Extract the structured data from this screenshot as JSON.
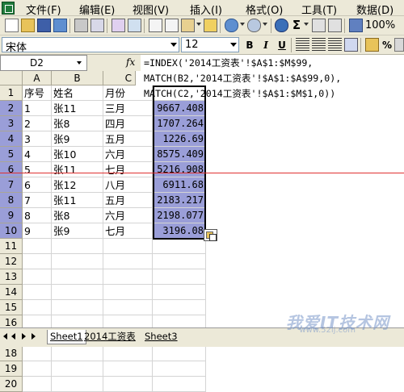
{
  "menu": [
    "文件(F)",
    "编辑(E)",
    "视图(V)",
    "插入(I)",
    "格式(O)",
    "工具(T)",
    "数据(D)"
  ],
  "toolbar": {
    "font_name": "宋体",
    "font_size": "12",
    "zoom": "100%",
    "bold": "B",
    "italic": "I",
    "underline": "U",
    "sigma": "Σ",
    "percent": "%"
  },
  "name_box": "D2",
  "fx_label": "fx",
  "formula_lines": [
    "=INDEX('2014工资表'!$A$1:$M$99,",
    "MATCH(B2,'2014工资表'!$A$1:$A$99,0),",
    "MATCH(C2,'2014工资表'!$A$1:$M$1,0))"
  ],
  "columns": [
    "A",
    "B",
    "C"
  ],
  "rows": [
    "1",
    "2",
    "3",
    "4",
    "5",
    "6",
    "7",
    "8",
    "9",
    "10",
    "11",
    "12",
    "13",
    "14",
    "15",
    "16",
    "17",
    "18",
    "19",
    "20"
  ],
  "header_row": [
    "序号",
    "姓名",
    "月份"
  ],
  "data": [
    {
      "seq": "1",
      "name": "张11",
      "month": "三月",
      "value": "9667.408"
    },
    {
      "seq": "2",
      "name": "张8",
      "month": "四月",
      "value": "1707.264"
    },
    {
      "seq": "3",
      "name": "张9",
      "month": "五月",
      "value": "1226.69"
    },
    {
      "seq": "4",
      "name": "张10",
      "month": "六月",
      "value": "8575.409"
    },
    {
      "seq": "5",
      "name": "张11",
      "month": "七月",
      "value": "5216.908"
    },
    {
      "seq": "6",
      "name": "张12",
      "month": "八月",
      "value": "6911.68"
    },
    {
      "seq": "7",
      "name": "张11",
      "month": "五月",
      "value": "2183.217"
    },
    {
      "seq": "8",
      "name": "张8",
      "month": "六月",
      "value": "2198.077"
    },
    {
      "seq": "9",
      "name": "张9",
      "month": "七月",
      "value": "3196.08"
    }
  ],
  "sheet_tabs": [
    "Sheet1",
    "2014工资表",
    "Sheet3"
  ],
  "watermark": "我爱IT技术网",
  "watermark_sub": "www.52ij.com",
  "colors": {
    "selection": "#9A9ED8",
    "chrome": "#ECE9D8",
    "red_line": "#E03030"
  }
}
